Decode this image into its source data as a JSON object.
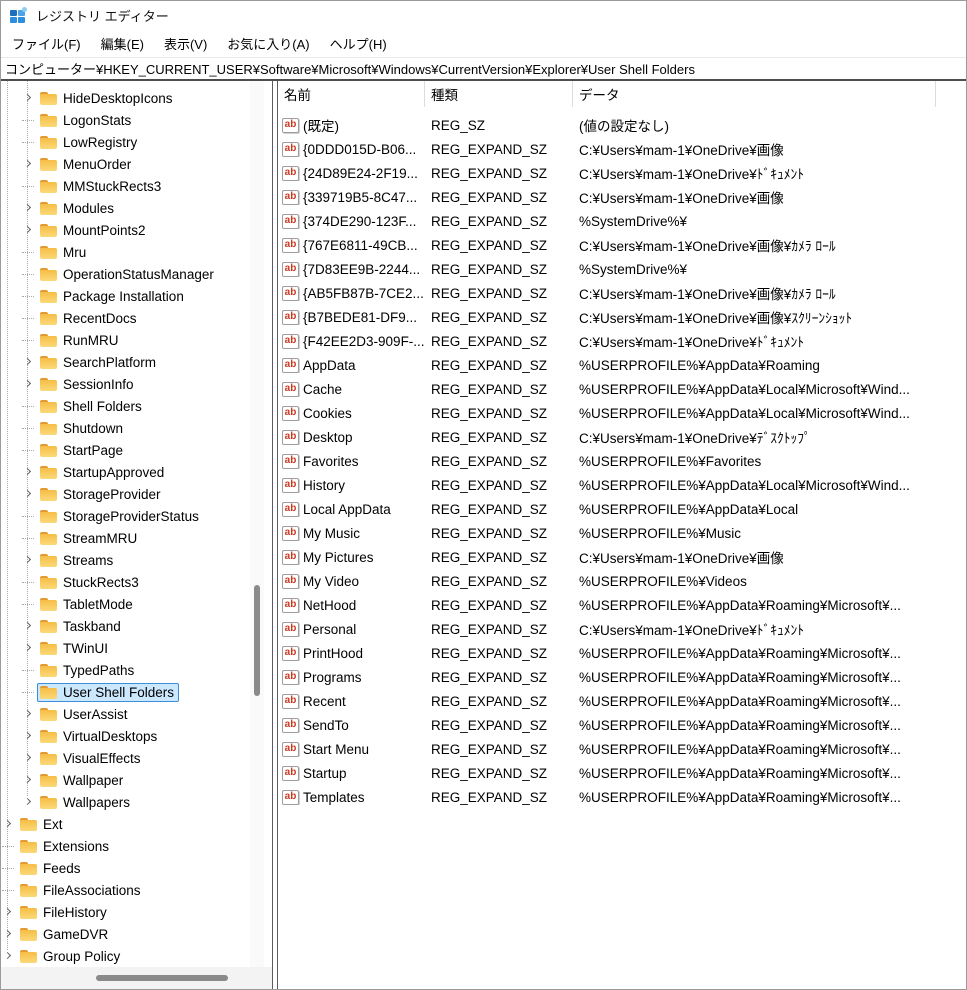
{
  "window": {
    "title": "レジストリ エディター"
  },
  "menu": {
    "items": [
      "ファイル(F)",
      "編集(E)",
      "表示(V)",
      "お気に入り(A)",
      "ヘルプ(H)"
    ]
  },
  "address_bar": {
    "path": "コンピューター¥HKEY_CURRENT_USER¥Software¥Microsoft¥Windows¥CurrentVersion¥Explorer¥User Shell Folders"
  },
  "tree": {
    "items": [
      {
        "label": "HideDesktopIcons",
        "level": 2,
        "expander": true,
        "selected": false
      },
      {
        "label": "LogonStats",
        "level": 2,
        "expander": false,
        "selected": false
      },
      {
        "label": "LowRegistry",
        "level": 2,
        "expander": false,
        "selected": false
      },
      {
        "label": "MenuOrder",
        "level": 2,
        "expander": true,
        "selected": false
      },
      {
        "label": "MMStuckRects3",
        "level": 2,
        "expander": false,
        "selected": false
      },
      {
        "label": "Modules",
        "level": 2,
        "expander": true,
        "selected": false
      },
      {
        "label": "MountPoints2",
        "level": 2,
        "expander": true,
        "selected": false
      },
      {
        "label": "Mru",
        "level": 2,
        "expander": false,
        "selected": false
      },
      {
        "label": "OperationStatusManager",
        "level": 2,
        "expander": false,
        "selected": false
      },
      {
        "label": "Package Installation",
        "level": 2,
        "expander": false,
        "selected": false
      },
      {
        "label": "RecentDocs",
        "level": 2,
        "expander": false,
        "selected": false
      },
      {
        "label": "RunMRU",
        "level": 2,
        "expander": false,
        "selected": false
      },
      {
        "label": "SearchPlatform",
        "level": 2,
        "expander": true,
        "selected": false
      },
      {
        "label": "SessionInfo",
        "level": 2,
        "expander": true,
        "selected": false
      },
      {
        "label": "Shell Folders",
        "level": 2,
        "expander": false,
        "selected": false
      },
      {
        "label": "Shutdown",
        "level": 2,
        "expander": false,
        "selected": false
      },
      {
        "label": "StartPage",
        "level": 2,
        "expander": false,
        "selected": false
      },
      {
        "label": "StartupApproved",
        "level": 2,
        "expander": true,
        "selected": false
      },
      {
        "label": "StorageProvider",
        "level": 2,
        "expander": true,
        "selected": false
      },
      {
        "label": "StorageProviderStatus",
        "level": 2,
        "expander": false,
        "selected": false
      },
      {
        "label": "StreamMRU",
        "level": 2,
        "expander": false,
        "selected": false
      },
      {
        "label": "Streams",
        "level": 2,
        "expander": true,
        "selected": false
      },
      {
        "label": "StuckRects3",
        "level": 2,
        "expander": false,
        "selected": false
      },
      {
        "label": "TabletMode",
        "level": 2,
        "expander": false,
        "selected": false
      },
      {
        "label": "Taskband",
        "level": 2,
        "expander": true,
        "selected": false
      },
      {
        "label": "TWinUI",
        "level": 2,
        "expander": true,
        "selected": false
      },
      {
        "label": "TypedPaths",
        "level": 2,
        "expander": false,
        "selected": false
      },
      {
        "label": "User Shell Folders",
        "level": 2,
        "expander": false,
        "selected": true
      },
      {
        "label": "UserAssist",
        "level": 2,
        "expander": true,
        "selected": false
      },
      {
        "label": "VirtualDesktops",
        "level": 2,
        "expander": true,
        "selected": false
      },
      {
        "label": "VisualEffects",
        "level": 2,
        "expander": true,
        "selected": false
      },
      {
        "label": "Wallpaper",
        "level": 2,
        "expander": true,
        "selected": false
      },
      {
        "label": "Wallpapers",
        "level": 2,
        "expander": true,
        "selected": false
      },
      {
        "label": "Ext",
        "level": 1,
        "expander": true,
        "selected": false
      },
      {
        "label": "Extensions",
        "level": 1,
        "expander": false,
        "selected": false
      },
      {
        "label": "Feeds",
        "level": 1,
        "expander": false,
        "selected": false
      },
      {
        "label": "FileAssociations",
        "level": 1,
        "expander": false,
        "selected": false
      },
      {
        "label": "FileHistory",
        "level": 1,
        "expander": true,
        "selected": false
      },
      {
        "label": "GameDVR",
        "level": 1,
        "expander": true,
        "selected": false
      },
      {
        "label": "Group Policy",
        "level": 1,
        "expander": true,
        "selected": false
      }
    ]
  },
  "table": {
    "columns": {
      "name": "名前",
      "type": "種類",
      "data": "データ"
    },
    "icon": {
      "name": "ab-string-icon",
      "glyph": "ab",
      "color": "#c83b20"
    },
    "rows": [
      {
        "name": "(既定)",
        "type": "REG_SZ",
        "data": "(値の設定なし)"
      },
      {
        "name": "{0DDD015D-B06...",
        "type": "REG_EXPAND_SZ",
        "data": "C:¥Users¥mam-1¥OneDrive¥画像"
      },
      {
        "name": "{24D89E24-2F19...",
        "type": "REG_EXPAND_SZ",
        "data": "C:¥Users¥mam-1¥OneDrive¥ﾄﾞｷｭﾒﾝﾄ"
      },
      {
        "name": "{339719B5-8C47...",
        "type": "REG_EXPAND_SZ",
        "data": "C:¥Users¥mam-1¥OneDrive¥画像"
      },
      {
        "name": "{374DE290-123F...",
        "type": "REG_EXPAND_SZ",
        "data": "%SystemDrive%¥"
      },
      {
        "name": "{767E6811-49CB...",
        "type": "REG_EXPAND_SZ",
        "data": "C:¥Users¥mam-1¥OneDrive¥画像¥ｶﾒﾗ ﾛｰﾙ"
      },
      {
        "name": "{7D83EE9B-2244...",
        "type": "REG_EXPAND_SZ",
        "data": "%SystemDrive%¥"
      },
      {
        "name": "{AB5FB87B-7CE2...",
        "type": "REG_EXPAND_SZ",
        "data": "C:¥Users¥mam-1¥OneDrive¥画像¥ｶﾒﾗ ﾛｰﾙ"
      },
      {
        "name": "{B7BEDE81-DF9...",
        "type": "REG_EXPAND_SZ",
        "data": "C:¥Users¥mam-1¥OneDrive¥画像¥ｽｸﾘｰﾝｼｮｯﾄ"
      },
      {
        "name": "{F42EE2D3-909F-...",
        "type": "REG_EXPAND_SZ",
        "data": "C:¥Users¥mam-1¥OneDrive¥ﾄﾞｷｭﾒﾝﾄ"
      },
      {
        "name": "AppData",
        "type": "REG_EXPAND_SZ",
        "data": "%USERPROFILE%¥AppData¥Roaming"
      },
      {
        "name": "Cache",
        "type": "REG_EXPAND_SZ",
        "data": "%USERPROFILE%¥AppData¥Local¥Microsoft¥Wind..."
      },
      {
        "name": "Cookies",
        "type": "REG_EXPAND_SZ",
        "data": "%USERPROFILE%¥AppData¥Local¥Microsoft¥Wind..."
      },
      {
        "name": "Desktop",
        "type": "REG_EXPAND_SZ",
        "data": "C:¥Users¥mam-1¥OneDrive¥ﾃﾞｽｸﾄｯﾌﾟ"
      },
      {
        "name": "Favorites",
        "type": "REG_EXPAND_SZ",
        "data": "%USERPROFILE%¥Favorites"
      },
      {
        "name": "History",
        "type": "REG_EXPAND_SZ",
        "data": "%USERPROFILE%¥AppData¥Local¥Microsoft¥Wind..."
      },
      {
        "name": "Local AppData",
        "type": "REG_EXPAND_SZ",
        "data": "%USERPROFILE%¥AppData¥Local"
      },
      {
        "name": "My Music",
        "type": "REG_EXPAND_SZ",
        "data": "%USERPROFILE%¥Music"
      },
      {
        "name": "My Pictures",
        "type": "REG_EXPAND_SZ",
        "data": "C:¥Users¥mam-1¥OneDrive¥画像"
      },
      {
        "name": "My Video",
        "type": "REG_EXPAND_SZ",
        "data": "%USERPROFILE%¥Videos"
      },
      {
        "name": "NetHood",
        "type": "REG_EXPAND_SZ",
        "data": "%USERPROFILE%¥AppData¥Roaming¥Microsoft¥..."
      },
      {
        "name": "Personal",
        "type": "REG_EXPAND_SZ",
        "data": "C:¥Users¥mam-1¥OneDrive¥ﾄﾞｷｭﾒﾝﾄ"
      },
      {
        "name": "PrintHood",
        "type": "REG_EXPAND_SZ",
        "data": "%USERPROFILE%¥AppData¥Roaming¥Microsoft¥..."
      },
      {
        "name": "Programs",
        "type": "REG_EXPAND_SZ",
        "data": "%USERPROFILE%¥AppData¥Roaming¥Microsoft¥..."
      },
      {
        "name": "Recent",
        "type": "REG_EXPAND_SZ",
        "data": "%USERPROFILE%¥AppData¥Roaming¥Microsoft¥..."
      },
      {
        "name": "SendTo",
        "type": "REG_EXPAND_SZ",
        "data": "%USERPROFILE%¥AppData¥Roaming¥Microsoft¥..."
      },
      {
        "name": "Start Menu",
        "type": "REG_EXPAND_SZ",
        "data": "%USERPROFILE%¥AppData¥Roaming¥Microsoft¥..."
      },
      {
        "name": "Startup",
        "type": "REG_EXPAND_SZ",
        "data": "%USERPROFILE%¥AppData¥Roaming¥Microsoft¥..."
      },
      {
        "name": "Templates",
        "type": "REG_EXPAND_SZ",
        "data": "%USERPROFILE%¥AppData¥Roaming¥Microsoft¥..."
      }
    ]
  },
  "colors": {
    "selection_bg": "#cce8ff",
    "selection_border": "#3b8fd9",
    "folder_amber": "#f6bd45",
    "folder_tab": "#e29a33",
    "ab_icon_red": "#c83b20",
    "pane_border": "#5c5c5c",
    "scroll_thumb": "#8a8a8a",
    "app_icon_blue": "#2f8fdf"
  }
}
